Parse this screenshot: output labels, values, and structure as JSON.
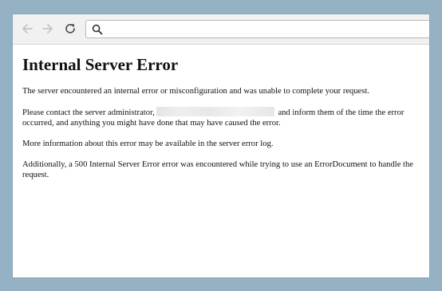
{
  "browser": {
    "address_bar": {
      "value": "",
      "placeholder": ""
    },
    "icons": {
      "back": "back-arrow-icon",
      "forward": "forward-arrow-icon",
      "reload": "reload-icon",
      "search": "search-icon"
    }
  },
  "page": {
    "title": "Internal Server Error",
    "paragraph1": "The server encountered an internal error or misconfiguration and was unable to complete your request.",
    "paragraph2_before": "Please contact the server administrator,",
    "paragraph2_after": "and inform them of the time the error occurred, and anything you might have done that may have caused the error.",
    "paragraph3": "More information about this error may be available in the server error log.",
    "paragraph4": "Additionally, a 500 Internal Server Error error was encountered while trying to use an ErrorDocument to handle the request."
  },
  "colors": {
    "frame_background": "#94b2c4",
    "toolbar_background": "#f1f1f1",
    "page_background": "#ffffff",
    "text": "#111111"
  }
}
